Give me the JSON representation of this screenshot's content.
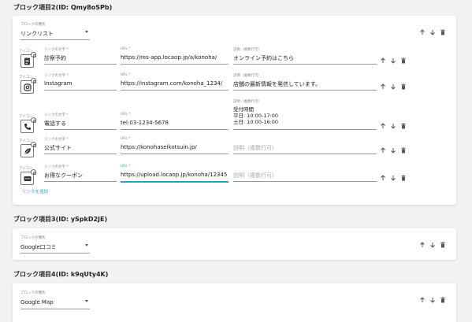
{
  "block2": {
    "title": "ブロック項目2(ID: Qmy8oSPb)",
    "type_label": "ブロックの種別",
    "type_value": "リンクリスト",
    "add_link_label": "リンクを追加",
    "links": [
      {
        "icon_label": "アイコン",
        "icon": "document-icon",
        "text_label": "リンクの文字 *",
        "text": "診察予約",
        "url_label": "URL *",
        "url": "https://res-app.locaop.jp/a/konoha/",
        "desc_label": "説明（複数行可）",
        "desc": "オンライン予約はこちら"
      },
      {
        "icon_label": "アイコン",
        "icon": "instagram-icon",
        "text_label": "リンクの文字 *",
        "text": "Instagram",
        "url_label": "URL *",
        "url": "https://instagram.com/konoha_1234/",
        "desc_label": "説明（複数行可）",
        "desc": "店舗の最新情報を発信しています。"
      },
      {
        "icon_label": "アイコン",
        "icon": "phone-icon",
        "text_label": "リンクの文字 *",
        "text": "電話する",
        "url_label": "URL *",
        "url": "tel:03-1234-5678",
        "desc_label": "説明（複数行可）",
        "desc_lines": [
          "受付時間",
          "平日: 10:00-17:00",
          "土日: 10:00-16:00"
        ]
      },
      {
        "icon_label": "アイコン",
        "icon": "leaf-icon",
        "text_label": "リンクの文字 *",
        "text": "公式サイト",
        "url_label": "URL *",
        "url": "https://konohaseikotsuin.jp/",
        "desc_placeholder": "説明（複数行可）"
      },
      {
        "icon_label": "アイコン",
        "icon": "coupon-icon",
        "text_label": "リンクの文字 *",
        "text": "お得なクーポン",
        "url_label": "URL *",
        "url": "https://upload.locaop.jp/konoha/12345",
        "desc_placeholder": "説明（複数行可）"
      }
    ]
  },
  "block3": {
    "title": "ブロック項目3(ID: ySpkD2JE)",
    "type_label": "ブロックの種別",
    "type_value": "Google口コミ"
  },
  "block4": {
    "title": "ブロック項目4(ID: k9qUty4K)",
    "type_label": "ブロックの種別",
    "type_value": "Google Map"
  },
  "colors": {
    "accent": "#2aa3c9",
    "icon": "#555555"
  }
}
